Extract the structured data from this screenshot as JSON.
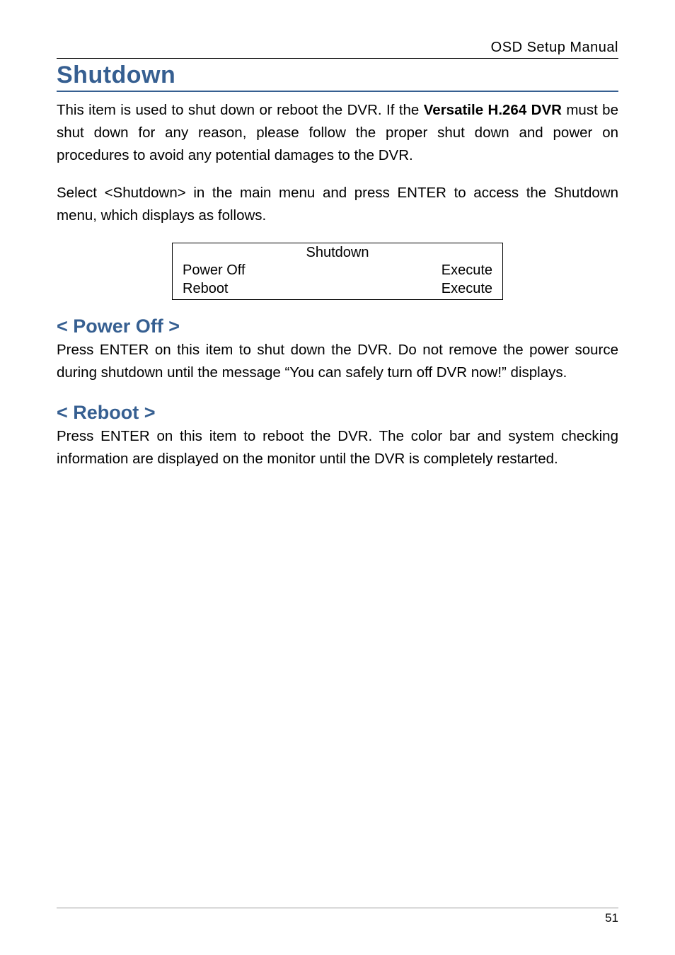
{
  "header": {
    "title": "OSD Setup Manual"
  },
  "h1": "Shutdown",
  "intro1_a": "This item is used to shut down or reboot the DVR. If the ",
  "intro1_bold": "Versatile H.264 DVR",
  "intro1_b": " must be shut down for any reason, please follow the proper shut down and power on procedures to avoid any potential damages to the DVR.",
  "intro2": "Select <Shutdown> in the main menu and press ENTER to access the Shutdown menu, which displays as follows.",
  "menu": {
    "title": "Shutdown",
    "rows": [
      {
        "label": "Power Off",
        "value": "Execute"
      },
      {
        "label": "Reboot",
        "value": "Execute"
      }
    ]
  },
  "sections": [
    {
      "heading": "< Power Off >",
      "body": "Press ENTER on this item to shut down the DVR. Do not remove the power source during shutdown until the message “You can safely turn off DVR now!” displays."
    },
    {
      "heading": "< Reboot >",
      "body": "Press ENTER on this item to reboot the DVR. The color bar and system checking information are displayed on the monitor until the DVR is completely restarted."
    }
  ],
  "footer": {
    "page": "51"
  }
}
